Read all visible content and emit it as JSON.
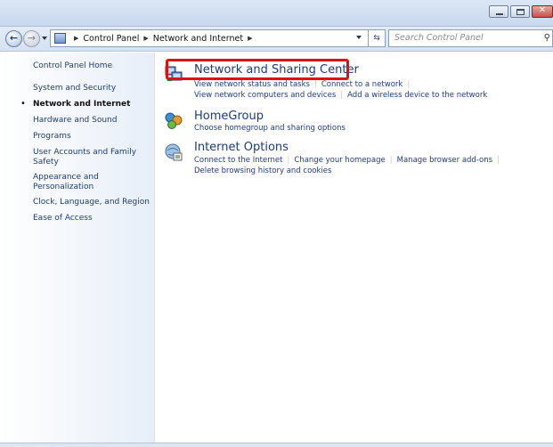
{
  "address": {
    "crumbs": [
      "Control Panel",
      "Network and Internet"
    ],
    "search_placeholder": "Search Control Panel"
  },
  "sidebar": {
    "items": [
      {
        "label": "Control Panel Home",
        "current": false
      },
      {
        "label": "System and Security",
        "current": false
      },
      {
        "label": "Network and Internet",
        "current": true
      },
      {
        "label": "Hardware and Sound",
        "current": false
      },
      {
        "label": "Programs",
        "current": false
      },
      {
        "label": "User Accounts and Family Safety",
        "current": false
      },
      {
        "label": "Appearance and Personalization",
        "current": false
      },
      {
        "label": "Clock, Language, and Region",
        "current": false
      },
      {
        "label": "Ease of Access",
        "current": false
      }
    ]
  },
  "categories": [
    {
      "title": "Network and Sharing Center",
      "tasks": [
        [
          "View network status and tasks",
          "Connect to a network"
        ],
        [
          "View network computers and devices",
          "Add a wireless device to the network"
        ]
      ]
    },
    {
      "title": "HomeGroup",
      "tasks": [
        [
          "Choose homegroup and sharing options"
        ]
      ]
    },
    {
      "title": "Internet Options",
      "tasks": [
        [
          "Connect to the Internet",
          "Change your homepage",
          "Manage browser add-ons"
        ],
        [
          "Delete browsing history and cookies"
        ]
      ]
    }
  ],
  "icons": {
    "window_minimize": "minimize-icon",
    "window_maximize": "maximize-icon",
    "window_close": "close-icon",
    "back": "back-arrow-icon",
    "forward": "forward-arrow-icon",
    "refresh": "refresh-icon",
    "search": "search-icon"
  },
  "colors": {
    "link": "#1e3c73",
    "category_title": "#1a3b80",
    "highlight": "#e01010"
  }
}
